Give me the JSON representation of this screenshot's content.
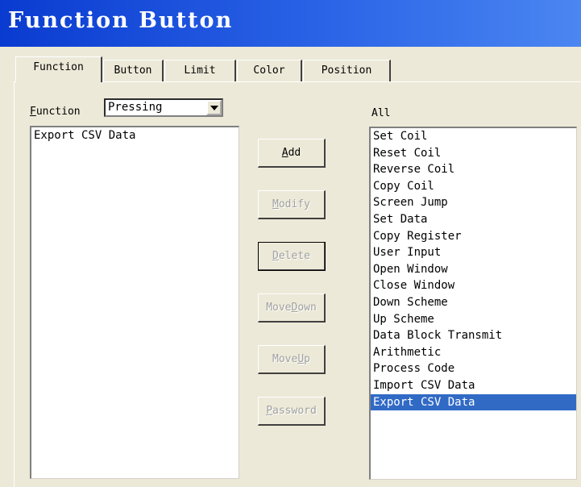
{
  "window": {
    "title": "Function Button"
  },
  "tabs": [
    {
      "label": "Function"
    },
    {
      "label": "Button"
    },
    {
      "label": "Limit"
    },
    {
      "label": "Color"
    },
    {
      "label": "Position"
    }
  ],
  "function_label": "Function",
  "function_select": {
    "value": "Pressing"
  },
  "left_list": {
    "items": [
      "Export CSV Data"
    ]
  },
  "all_label": "All",
  "all_list": {
    "items": [
      "Set Coil",
      "Reset Coil",
      "Reverse Coil",
      "Copy Coil",
      "Screen Jump",
      "Set Data",
      "Copy Register",
      "User Input",
      "Open Window",
      "Close Window",
      "Down Scheme",
      "Up Scheme",
      "Data Block Transmit",
      "Arithmetic",
      "Process Code",
      "Import CSV Data",
      "Export CSV Data"
    ],
    "selected": "Export CSV Data"
  },
  "buttons": {
    "add": "Add",
    "modify": "Modify",
    "delete": "Delete",
    "move_down": "Move Down",
    "move_up": "Move Up",
    "password": "Password"
  }
}
